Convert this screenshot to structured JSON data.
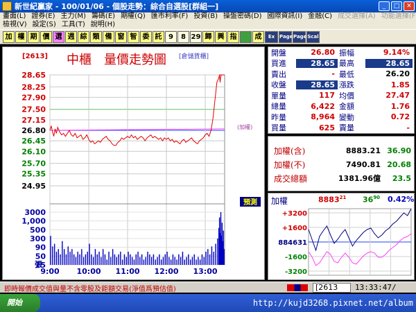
{
  "window": {
    "title": "新世紀贏家 - 100/01/06 - 個股走勢：綜合自選股[群組一]"
  },
  "menu": {
    "row1": [
      "畫面(L)",
      "證券(E)",
      "主力(M)",
      "籌碼(E)",
      "期權(Q)",
      "匯市利率(F)",
      "投資(B)",
      "操盤密碼(D)",
      "國際資訊(I)",
      "金融(C)",
      "成交選擇(A)",
      "功能選擇(F)"
    ],
    "row2": [
      "檢視(V)",
      "設定(S)",
      "工具(T)",
      "說明(H)"
    ]
  },
  "toolbar": [
    "加",
    "權",
    "期",
    "價",
    "選",
    "週",
    "綜",
    "類",
    "備",
    "窗",
    "智",
    "委",
    "託",
    "9",
    "8",
    "29",
    "歸",
    "興",
    "指",
    "",
    "成",
    "Ex",
    "Page",
    "Page",
    "Scal"
  ],
  "chart": {
    "code": "[2613]",
    "title": "中櫃　量價走勢圖",
    "note": "[倉儲貨櫃]",
    "ref_label": "(加權)",
    "signal_label": "預測",
    "vol_unit": "張"
  },
  "quote": {
    "rows": [
      {
        "l1": "開盤",
        "v1": "26.80",
        "c1": "red",
        "l2": "振幅",
        "v2": "9.14%",
        "c2": "red"
      },
      {
        "l1": "買進",
        "v1": "28.65",
        "c1": "hl",
        "l2": "最高",
        "v2": "28.65",
        "c2": "hl"
      },
      {
        "l1": "賣出",
        "v1": "-",
        "c1": "red",
        "l2": "最低",
        "v2": "26.20",
        "c2": "black"
      },
      {
        "l1": "收盤",
        "v1": "28.65",
        "c1": "hl",
        "l2": "漲跌",
        "v2": "1.85",
        "c2": "red"
      },
      {
        "l1": "單量",
        "v1": "117",
        "c1": "red",
        "l2": "均價",
        "v2": "27.47",
        "c2": "red"
      },
      {
        "l1": "總量",
        "v1": "6,422",
        "c1": "red",
        "l2": "金額",
        "v2": "1.76",
        "c2": "red"
      },
      {
        "l1": "昨量",
        "v1": "8,964",
        "c1": "red",
        "l2": "變動",
        "v2": "0.72",
        "c2": "red"
      },
      {
        "l1": "買量",
        "v1": "625",
        "c1": "red",
        "l2": "賣量",
        "v2": "-",
        "c2": "red"
      }
    ]
  },
  "index": {
    "rows": [
      {
        "label": "加權(含)",
        "value": "8883.21",
        "change": "36.90"
      },
      {
        "label": "加權(不)",
        "value": "7490.81",
        "change": "20.68"
      },
      {
        "label": "成交總額",
        "value": "1381.96億",
        "change": "23.5"
      }
    ]
  },
  "mini": {
    "label": "加權",
    "value": "8883",
    "value_sup": "21",
    "change": "36",
    "change_sup": "90",
    "pct": "0.42%",
    "yticks": [
      "+3200",
      "+1600",
      "884631",
      "-1600",
      "-3200"
    ]
  },
  "status": {
    "message": "即時報價成交值與量不含零股及鉅額交易(淨值爲預估值)",
    "code": "[2613",
    "clock": "13:33:47/"
  },
  "taskbar": {
    "start": "開始",
    "watermark": "http://kujd3268.pixnet.net/album"
  },
  "chart_data": {
    "type": "line",
    "price_axis": [
      "28.65",
      "28.25",
      "27.90",
      "27.50",
      "27.15",
      "26.80",
      "26.45",
      "26.10",
      "25.70",
      "25.35",
      "24.95"
    ],
    "volume_axis": [
      "3000",
      "1,000",
      "500",
      "300",
      "90",
      "50",
      "15"
    ],
    "time_ticks": [
      "9:00",
      "10:00",
      "11:00",
      "12:00",
      "13:00"
    ],
    "reference_price": 26.8,
    "price_series": {
      "t": [
        0,
        2,
        4,
        6,
        8,
        10,
        12,
        15,
        18,
        21,
        24,
        27,
        30,
        33,
        36,
        39,
        42,
        45,
        48,
        51,
        54,
        57,
        60,
        63,
        66,
        69,
        72,
        75,
        78,
        81,
        84,
        87,
        90,
        93,
        96,
        99,
        102,
        105,
        108,
        111,
        114,
        117,
        120,
        123,
        126,
        129,
        132,
        135,
        138,
        141,
        144,
        147,
        150,
        153,
        156,
        159,
        162,
        165,
        168,
        171,
        174,
        177,
        180,
        183,
        186,
        189,
        192,
        195,
        198,
        201,
        204,
        207,
        210,
        213,
        216,
        219,
        222,
        225,
        228,
        231,
        234,
        237,
        240,
        243,
        246,
        249,
        252,
        255,
        258,
        261,
        262,
        263,
        264,
        265,
        266,
        268,
        270
      ],
      "price": [
        26.8,
        26.95,
        26.75,
        26.6,
        26.85,
        26.7,
        26.9,
        26.75,
        26.65,
        26.7,
        26.6,
        26.7,
        26.8,
        26.65,
        26.6,
        26.7,
        26.55,
        26.6,
        26.65,
        26.5,
        26.55,
        26.65,
        26.5,
        26.4,
        26.45,
        26.35,
        26.4,
        26.45,
        26.4,
        26.5,
        26.55,
        26.6,
        26.5,
        26.45,
        26.35,
        26.3,
        26.3,
        26.4,
        26.45,
        26.55,
        26.5,
        26.55,
        26.6,
        26.55,
        26.65,
        26.55,
        26.6,
        26.5,
        26.55,
        26.6,
        26.55,
        26.45,
        26.55,
        26.6,
        26.65,
        26.55,
        26.6,
        26.55,
        26.5,
        26.55,
        26.45,
        26.55,
        26.5,
        26.55,
        26.45,
        26.5,
        26.4,
        26.45,
        26.4,
        26.35,
        26.45,
        26.5,
        26.4,
        26.45,
        26.5,
        26.55,
        26.45,
        26.4,
        26.35,
        26.45,
        26.5,
        26.55,
        26.65,
        26.7,
        26.6,
        26.8,
        27.2,
        27.8,
        28.4,
        28.55,
        28.65,
        28.4,
        28.6,
        28.65,
        28.65,
        28.65,
        28.65
      ]
    },
    "average_series": {
      "t": [
        0,
        270
      ],
      "price": [
        26.8,
        26.85
      ]
    },
    "volume_series": {
      "t": [
        1,
        4,
        7,
        10,
        13,
        16,
        19,
        22,
        25,
        28,
        31,
        34,
        37,
        40,
        43,
        46,
        49,
        52,
        55,
        58,
        61,
        64,
        67,
        70,
        73,
        76,
        79,
        82,
        85,
        88,
        91,
        94,
        97,
        100,
        103,
        106,
        109,
        112,
        115,
        118,
        121,
        124,
        127,
        130,
        133,
        136,
        139,
        142,
        145,
        148,
        151,
        154,
        157,
        160,
        163,
        166,
        169,
        172,
        175,
        178,
        181,
        184,
        187,
        190,
        193,
        196,
        199,
        202,
        205,
        208,
        211,
        214,
        217,
        220,
        223,
        226,
        229,
        232,
        235,
        238,
        241,
        244,
        247,
        250,
        253,
        256,
        259,
        261,
        262,
        263,
        264,
        265,
        266,
        267,
        268,
        269
      ],
      "level": [
        0.55,
        0.35,
        0.4,
        0.25,
        0.3,
        0.2,
        0.45,
        0.3,
        0.2,
        0.35,
        0.25,
        0.3,
        0.2,
        0.15,
        0.25,
        0.2,
        0.3,
        0.15,
        0.2,
        0.25,
        0.4,
        0.2,
        0.15,
        0.3,
        0.2,
        0.25,
        0.15,
        0.3,
        0.2,
        0.1,
        0.25,
        0.15,
        0.3,
        0.2,
        0.15,
        0.2,
        0.25,
        0.1,
        0.2,
        0.15,
        0.25,
        0.2,
        0.15,
        0.1,
        0.2,
        0.25,
        0.15,
        0.2,
        0.1,
        0.15,
        0.25,
        0.2,
        0.15,
        0.2,
        0.1,
        0.15,
        0.2,
        0.1,
        0.15,
        0.2,
        0.25,
        0.15,
        0.1,
        0.2,
        0.15,
        0.1,
        0.2,
        0.15,
        0.25,
        0.1,
        0.15,
        0.2,
        0.1,
        0.15,
        0.2,
        0.1,
        0.15,
        0.1,
        0.2,
        0.15,
        0.25,
        0.3,
        0.2,
        0.35,
        0.25,
        0.4,
        0.5,
        0.7,
        0.9,
        0.6,
        1.0,
        0.55,
        0.8,
        0.45,
        0.65,
        0.3
      ]
    }
  }
}
